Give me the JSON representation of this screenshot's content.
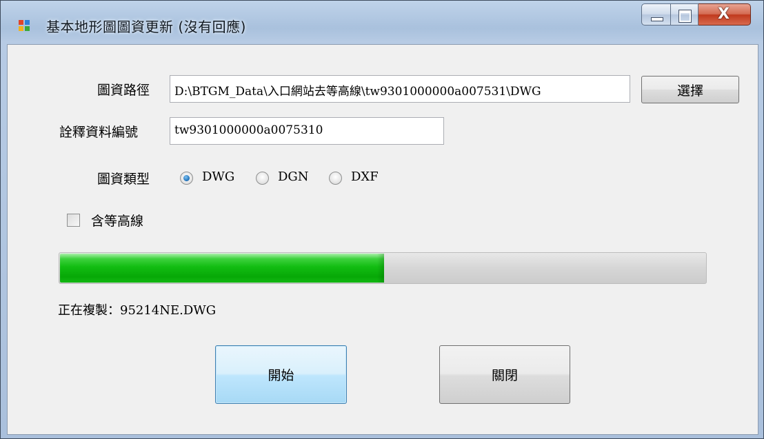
{
  "window": {
    "title": "基本地形圖圖資更新 (沒有回應)"
  },
  "form": {
    "path_label": "圖資路徑",
    "path_value": "D:\\BTGM_Data\\入口網站去等高線\\tw9301000000a007531\\DWG",
    "select_button": "選擇",
    "id_label": "詮釋資料編號",
    "id_value": "tw9301000000a0075310",
    "type_label": "圖資類型",
    "type_options": [
      "DWG",
      "DGN",
      "DXF"
    ],
    "type_selected": "DWG",
    "contour_label": "含等高線",
    "contour_checked": false
  },
  "progress": {
    "fraction": 0.503
  },
  "status": {
    "prefix": "正在複製：",
    "file": "95214NE.DWG"
  },
  "buttons": {
    "start": "開始",
    "close": "關閉"
  },
  "colors": {
    "progress_fill": "#12bd12",
    "focused_button": "#bee6fd",
    "close_caption": "#c0391d"
  }
}
